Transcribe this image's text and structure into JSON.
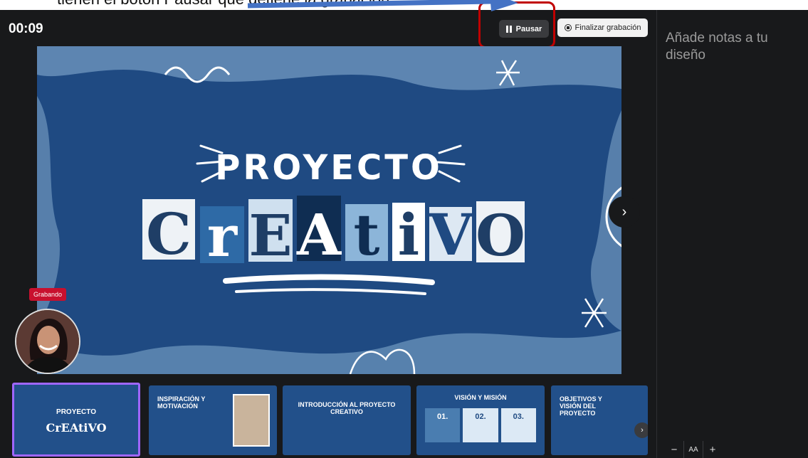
{
  "caption": {
    "text": "tienen el botón Pausar que detiene la grabación."
  },
  "toolbar": {
    "timer": "00:09",
    "pause_label": "Pausar",
    "end_label": "Finalizar grabación"
  },
  "notes": {
    "placeholder": "Añade notas a tu diseño"
  },
  "recording": {
    "badge": "Grabando"
  },
  "slide": {
    "line1": "PROYECTO",
    "line2": "CrEAtiVO"
  },
  "thumbnails": [
    {
      "title": "PROYECTO",
      "subtitle": "CrEAtiVO"
    },
    {
      "title": "INSPIRACIÓN Y MOTIVACIÓN"
    },
    {
      "title": "INTRODUCCIÓN AL PROYECTO CREATIVO"
    },
    {
      "title": "VISIÓN Y MISIÓN",
      "cols": [
        "01.",
        "02.",
        "03."
      ]
    },
    {
      "title": "OBJETIVOS Y VISIÓN DEL PROYECTO"
    }
  ],
  "zoom": {
    "minus": "−",
    "aa": "AA",
    "plus": "+"
  },
  "colors": {
    "accent": "#a066ff",
    "highlight": "#c00000",
    "recording": "#c8102e",
    "slide_bg": "#1f4a82"
  }
}
